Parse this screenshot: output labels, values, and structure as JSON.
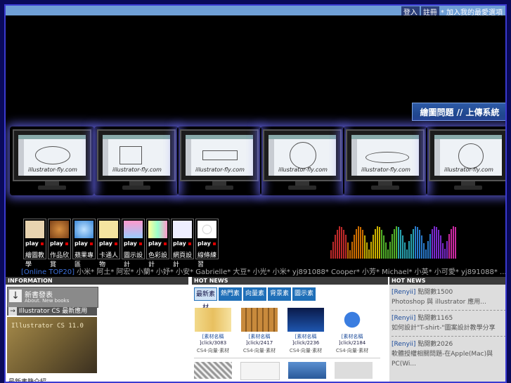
{
  "topbar": {
    "btn1": "登入",
    "btn2": "註冊",
    "text": "* 加入我的最愛選項"
  },
  "banner": {
    "upload_label": "繪圖問題 // 上傳系統",
    "screen_caption": "illustrator-fly.com"
  },
  "thumbs": [
    {
      "label": "繪圖教學",
      "play": "play"
    },
    {
      "label": "作品欣賞",
      "play": "play"
    },
    {
      "label": "蘋果專區",
      "play": "play"
    },
    {
      "label": "卡通人物",
      "play": "play"
    },
    {
      "label": "圖示設計",
      "play": "play"
    },
    {
      "label": "色彩設計",
      "play": "play"
    },
    {
      "label": "網頁設計",
      "play": "play"
    },
    {
      "label": "線條練習",
      "play": "play"
    }
  ],
  "ticker": {
    "first": "[Online TOP20]",
    "rest": "小米* 阿土* 阿宏* 小蘭* 小妤* 小安* Gabrielle* 大豆* 小光* 小米* yj891088* Cooper* 小芳* Michael* 小英* 小可愛* yj891088* ..."
  },
  "info": {
    "header": "INFORMATION",
    "newbook_title": "新書發表",
    "newbook_sub": "About. New books",
    "il_label": "Illustrator CS 最新應用",
    "book_text": "Illustrator CS 11.0",
    "more": "最新書籍介紹.."
  },
  "hot": {
    "header": "HOT NEWS",
    "tabs": [
      "最新素材",
      "熱門素材",
      "向量素材",
      "背景素材",
      "圖示素材"
    ],
    "items": [
      {
        "title": "[素材名稱",
        "stats": "]click/3083",
        "sub": "CS4·向量·素材"
      },
      {
        "title": "[素材名稱",
        "stats": "]click/2417",
        "sub": "CS4·向量·素材"
      },
      {
        "title": "[素材名稱",
        "stats": "]click/2236",
        "sub": "CS4·向量·素材"
      },
      {
        "title": "[素材名稱",
        "stats": "]click/2184",
        "sub": "CS4·向量·素材"
      }
    ]
  },
  "news": {
    "header": "HOT NEWS",
    "items": [
      {
        "who": "[Renyii]",
        "count": " 點閱數1500",
        "text": "Photoshop 與 illustrator 應用..."
      },
      {
        "who": "[Renyii]",
        "count": " 點閱數1165",
        "text": "如何設計\"T-shirt-\"圖案設計教學分享"
      },
      {
        "who": "[Renyii]",
        "count": " 點閱數2026",
        "text": "軟體授權相關問題-在Apple(Mac)與PC(Wi..."
      }
    ]
  }
}
